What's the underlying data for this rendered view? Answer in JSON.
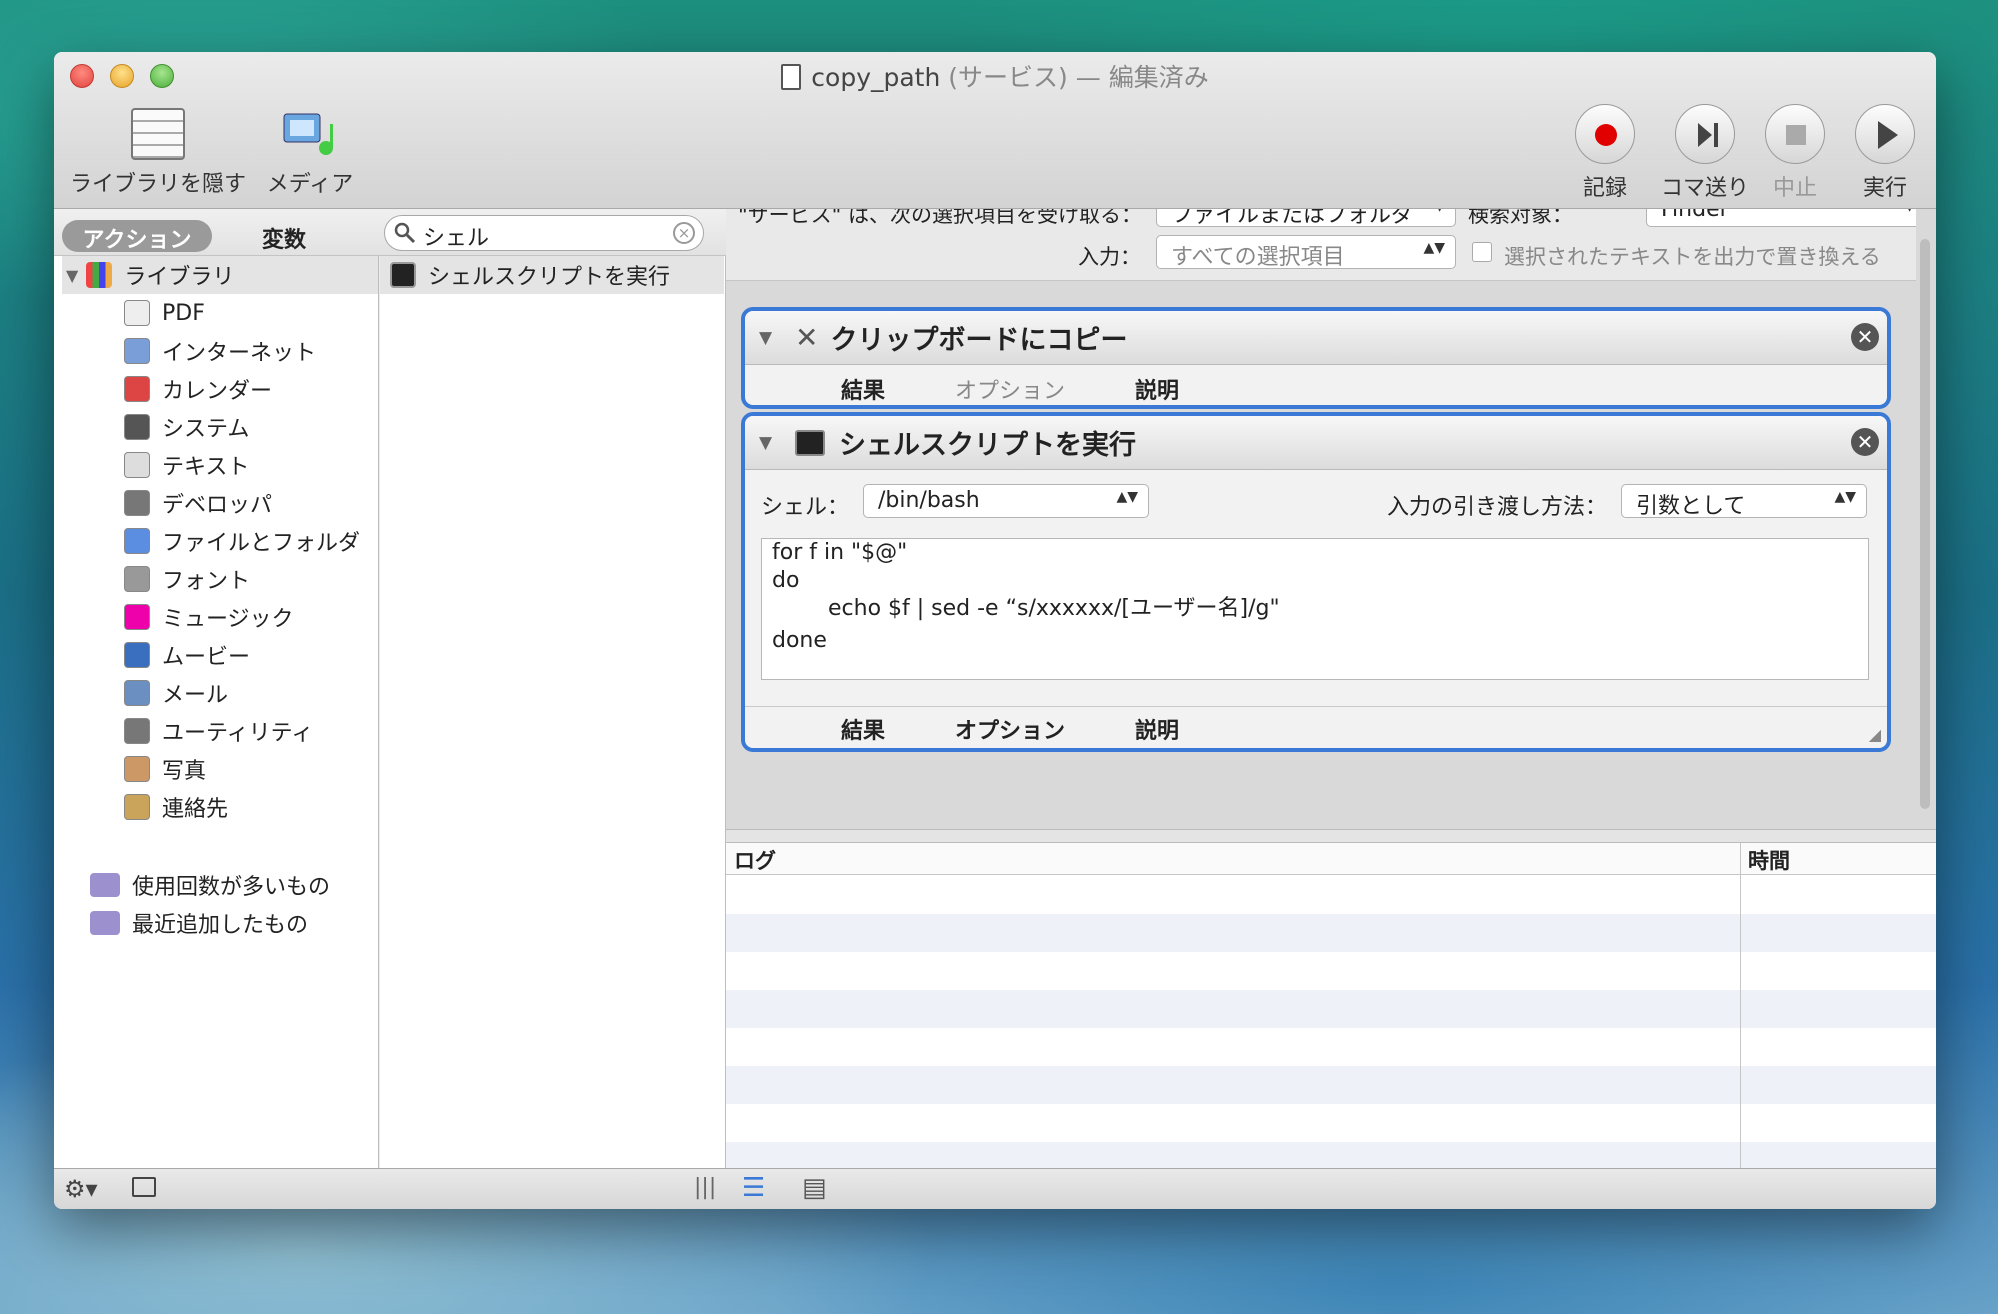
{
  "window": {
    "title": "copy_path",
    "title_kind": "(サービス)",
    "title_status": "— 編集済み"
  },
  "toolbar": {
    "hide_library": "ライブラリを隠す",
    "media": "メディア",
    "record": "記録",
    "step": "コマ送り",
    "stop": "中止",
    "run": "実行"
  },
  "sidebar": {
    "tab_actions": "アクション",
    "tab_variables": "変数",
    "search_value": "シェル",
    "library_label": "ライブラリ",
    "items": [
      {
        "label": "PDF",
        "icon": "pdf-icon"
      },
      {
        "label": "インターネット",
        "icon": "internet-icon"
      },
      {
        "label": "カレンダー",
        "icon": "calendar-icon"
      },
      {
        "label": "システム",
        "icon": "system-icon"
      },
      {
        "label": "テキスト",
        "icon": "text-icon"
      },
      {
        "label": "デベロッパ",
        "icon": "developer-icon"
      },
      {
        "label": "ファイルとフォルダ",
        "icon": "finder-icon"
      },
      {
        "label": "フォント",
        "icon": "font-icon"
      },
      {
        "label": "ミュージック",
        "icon": "music-icon"
      },
      {
        "label": "ムービー",
        "icon": "movie-icon"
      },
      {
        "label": "メール",
        "icon": "mail-icon"
      },
      {
        "label": "ユーティリティ",
        "icon": "utility-icon"
      },
      {
        "label": "写真",
        "icon": "photo-icon"
      },
      {
        "label": "連絡先",
        "icon": "contacts-icon"
      }
    ],
    "smart_folders": [
      "使用回数が多いもの",
      "最近追加したもの"
    ],
    "result": "シェルスクリプトを実行"
  },
  "service": {
    "receives_label": "\"サービス\" は、次の選択項目を受け取る：",
    "receives_value": "ファイルまたはフォルダ",
    "in_label": "検索対象：",
    "in_value": "Finder",
    "input_label": "入力：",
    "input_value": "すべての選択項目",
    "replace_label": "選択されたテキストを出力で置き換える"
  },
  "actions": [
    {
      "title": "クリップボードにコピー",
      "tabs": [
        "結果",
        "オプション",
        "説明"
      ]
    },
    {
      "title": "シェルスクリプトを実行",
      "shell_label": "シェル：",
      "shell_value": "/bin/bash",
      "pass_label": "入力の引き渡し方法：",
      "pass_value": "引数として",
      "script": [
        "for f in \"$@\"",
        "do",
        "echo $f | sed -e “s/xxxxxx/[ユーザー名]/g\"",
        "done"
      ],
      "tabs": [
        "結果",
        "オプション",
        "説明"
      ]
    }
  ],
  "log": {
    "col_log": "ログ",
    "col_time": "時間"
  },
  "colors": {
    "accent": "#3a7ad6",
    "record": "#e00000"
  }
}
